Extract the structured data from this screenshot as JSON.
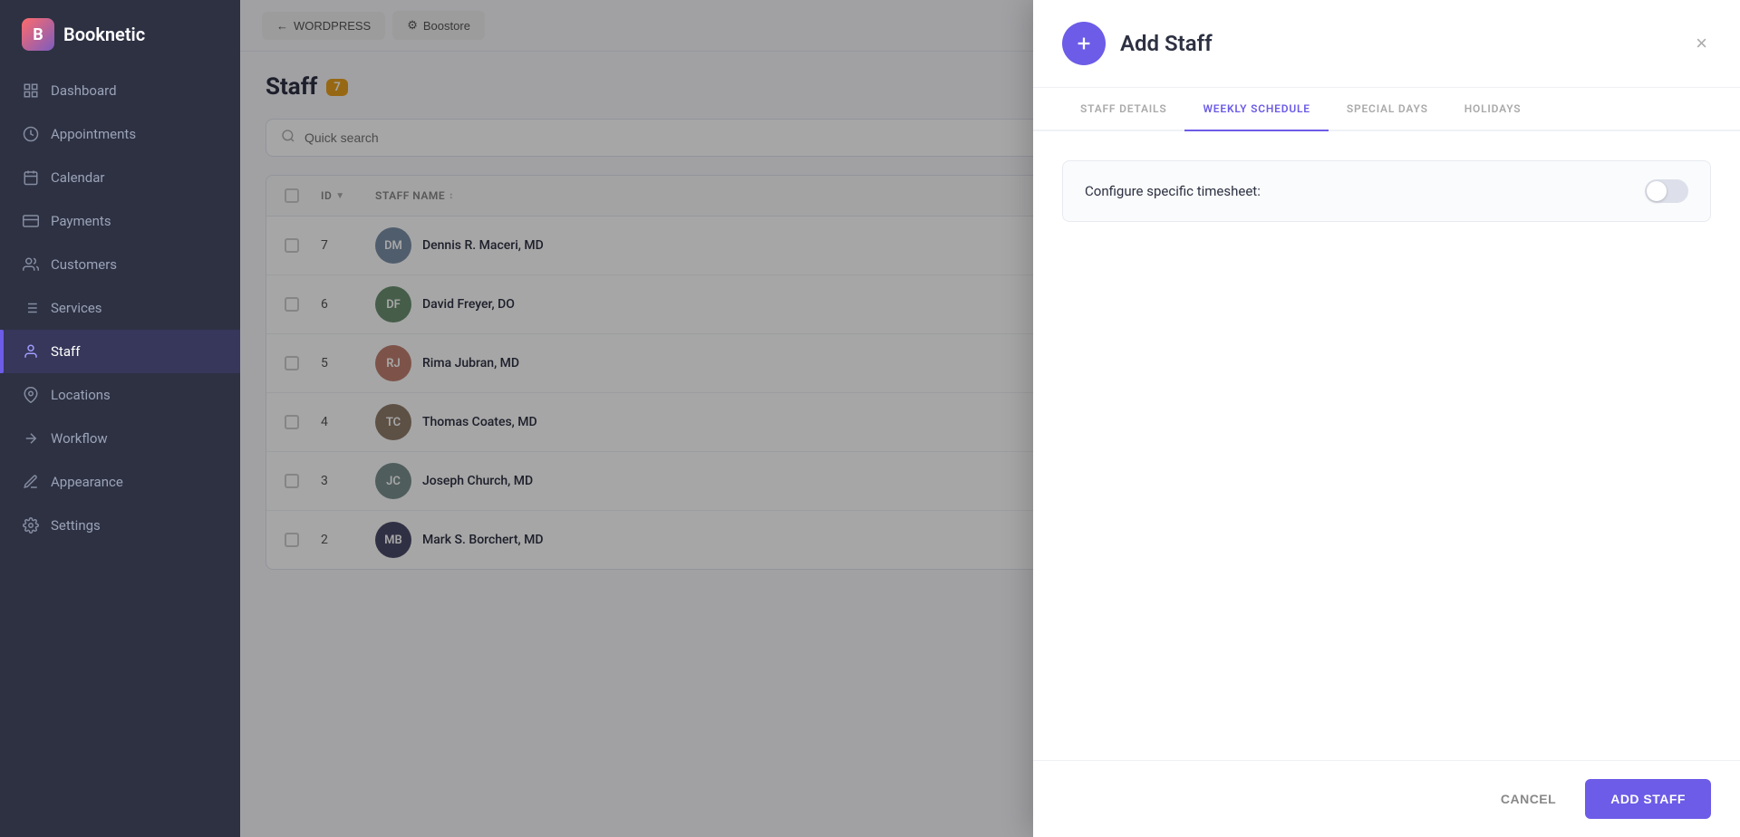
{
  "app": {
    "name": "Booknetic",
    "logo_letter": "B"
  },
  "nav": {
    "items": [
      {
        "id": "dashboard",
        "label": "Dashboard",
        "icon": "grid"
      },
      {
        "id": "appointments",
        "label": "Appointments",
        "icon": "clock"
      },
      {
        "id": "calendar",
        "label": "Calendar",
        "icon": "calendar"
      },
      {
        "id": "payments",
        "label": "Payments",
        "icon": "credit-card"
      },
      {
        "id": "customers",
        "label": "Customers",
        "icon": "users"
      },
      {
        "id": "services",
        "label": "Services",
        "icon": "list"
      },
      {
        "id": "staff",
        "label": "Staff",
        "icon": "person",
        "active": true
      },
      {
        "id": "locations",
        "label": "Locations",
        "icon": "pin"
      },
      {
        "id": "workflow",
        "label": "Workflow",
        "icon": "arrow"
      },
      {
        "id": "appearance",
        "label": "Appearance",
        "icon": "pen"
      },
      {
        "id": "settings",
        "label": "Settings",
        "icon": "gear"
      }
    ]
  },
  "topbar": {
    "wordpress_label": "WORDPRESS",
    "boostore_label": "Boostore"
  },
  "page": {
    "title": "Staff",
    "count": "7",
    "search_placeholder": "Quick search"
  },
  "table": {
    "columns": [
      {
        "id": "id",
        "label": "ID"
      },
      {
        "id": "staff_name",
        "label": "STAFF NAME"
      }
    ],
    "rows": [
      {
        "id": "7",
        "name": "Dennis R. Maceri, MD",
        "color": "#7b8fa8"
      },
      {
        "id": "6",
        "name": "David Freyer, DO",
        "color": "#6b8f71"
      },
      {
        "id": "5",
        "name": "Rima Jubran, MD",
        "color": "#a87b6b"
      },
      {
        "id": "4",
        "name": "Thomas Coates, MD",
        "color": "#8f7b6b"
      },
      {
        "id": "3",
        "name": "Joseph Church, MD",
        "color": "#7b8f8f"
      },
      {
        "id": "2",
        "name": "Mark S. Borchert, MD",
        "color": "#4a4a6a"
      }
    ]
  },
  "modal": {
    "title": "Add Staff",
    "close_label": "×",
    "tabs": [
      {
        "id": "staff_details",
        "label": "STAFF DETAILS",
        "active": false
      },
      {
        "id": "weekly_schedule",
        "label": "WEEKLY SCHEDULE",
        "active": true
      },
      {
        "id": "special_days",
        "label": "SPECIAL DAYS",
        "active": false
      },
      {
        "id": "holidays",
        "label": "HOLIDAYS",
        "active": false
      }
    ],
    "timesheet_label": "Configure specific timesheet:",
    "toggle_on": false,
    "footer": {
      "cancel_label": "CANCEL",
      "add_label": "ADD STAFF"
    }
  },
  "colors": {
    "accent": "#6c5ce7",
    "sidebar_bg": "#2d3142",
    "badge_bg": "#e8a020"
  }
}
